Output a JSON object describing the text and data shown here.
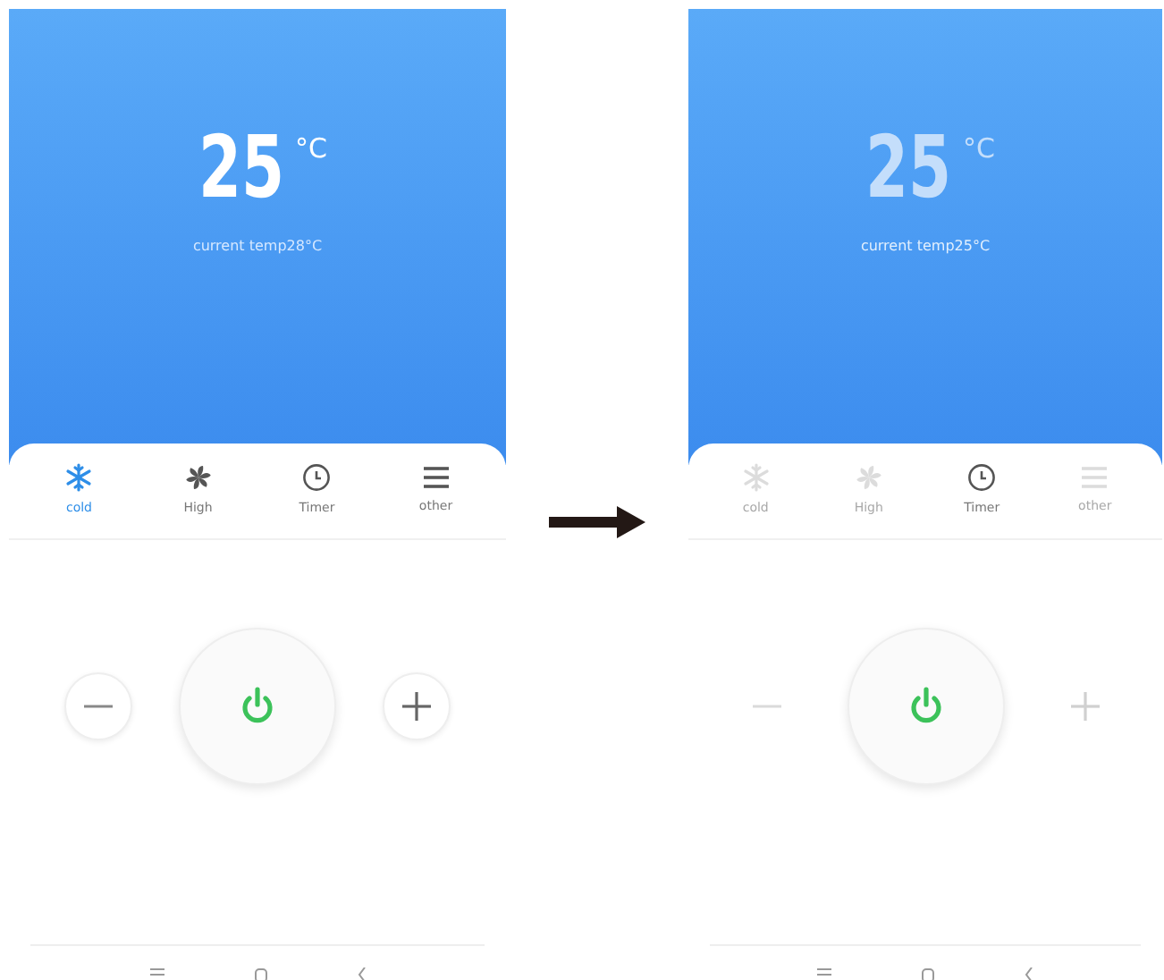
{
  "screens": [
    {
      "temperature": "25",
      "unit": "°C",
      "current_temp": "current temp28°C",
      "powered": true,
      "modes": [
        {
          "kind": "snowflake",
          "label": "cold",
          "selected": true,
          "disabled": false
        },
        {
          "kind": "fan",
          "label": "High",
          "selected": false,
          "disabled": false
        },
        {
          "kind": "clock",
          "label": "Timer",
          "selected": false,
          "disabled": false
        },
        {
          "kind": "menu",
          "label": "other",
          "selected": false,
          "disabled": false
        }
      ]
    },
    {
      "temperature": "25",
      "unit": "°C",
      "current_temp": "current temp25°C",
      "powered": false,
      "modes": [
        {
          "kind": "snowflake",
          "label": "cold",
          "selected": false,
          "disabled": true
        },
        {
          "kind": "fan",
          "label": "High",
          "selected": false,
          "disabled": true
        },
        {
          "kind": "clock",
          "label": "Timer",
          "selected": false,
          "disabled": false
        },
        {
          "kind": "menu",
          "label": "other",
          "selected": false,
          "disabled": true
        }
      ]
    }
  ]
}
